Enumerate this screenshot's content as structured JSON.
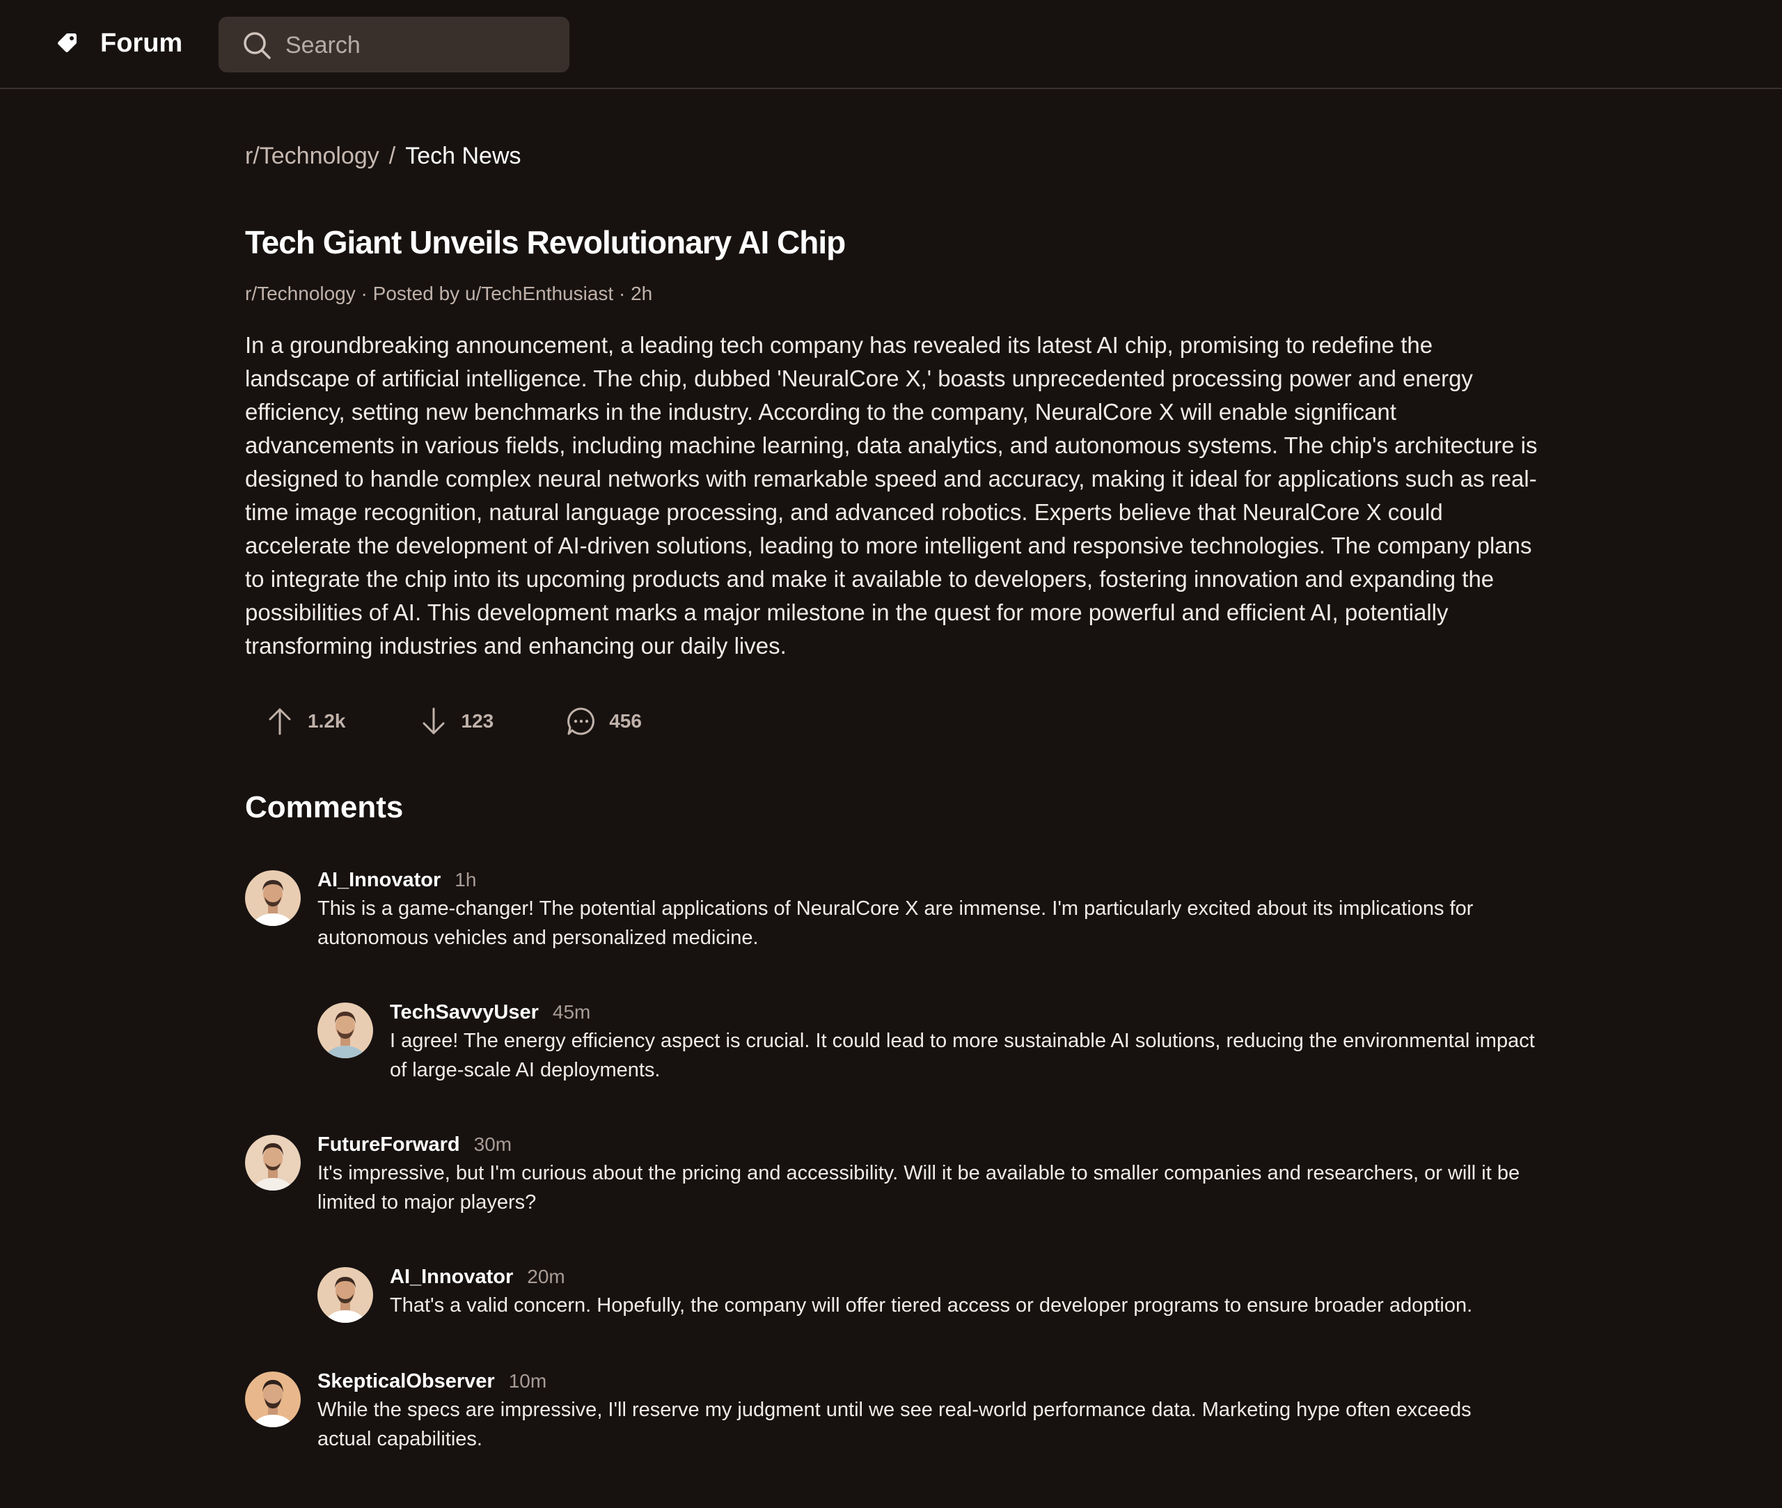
{
  "header": {
    "app_name": "Forum",
    "search_placeholder": "Search"
  },
  "breadcrumb": {
    "community": "r/Technology",
    "separator": "/",
    "current": "Tech News"
  },
  "post": {
    "title": "Tech Giant Unveils Revolutionary AI Chip",
    "meta": "r/Technology · Posted by u/TechEnthusiast · 2h",
    "body": "In a groundbreaking announcement, a leading tech company has revealed its latest AI chip, promising to redefine the landscape of artificial intelligence. The chip, dubbed 'NeuralCore X,' boasts unprecedented processing power and energy efficiency, setting new benchmarks in the industry. According to the company, NeuralCore X will enable significant advancements in various fields, including machine learning, data analytics, and autonomous systems. The chip's architecture is designed to handle complex neural networks with remarkable speed and accuracy, making it ideal for applications such as real-time image recognition, natural language processing, and advanced robotics. Experts believe that NeuralCore X could accelerate the development of AI-driven solutions, leading to more intelligent and responsive technologies. The company plans to integrate the chip into its upcoming products and make it available to developers, fostering innovation and expanding the possibilities of AI. This development marks a major milestone in the quest for more powerful and efficient AI, potentially transforming industries and enhancing our daily lives.",
    "upvotes": "1.2k",
    "downvotes": "123",
    "comment_count": "456"
  },
  "comments_heading": "Comments",
  "comments": [
    {
      "user": "AI_Innovator",
      "time": "1h",
      "text": "This is a game-changer! The potential applications of NeuralCore X are immense. I'm particularly excited about its implications for autonomous vehicles and personalized medicine."
    },
    {
      "user": "TechSavvyUser",
      "time": "45m",
      "text": "I agree! The energy efficiency aspect is crucial. It could lead to more sustainable AI solutions, reducing the environmental impact of large-scale AI deployments."
    },
    {
      "user": "FutureForward",
      "time": "30m",
      "text": "It's impressive, but I'm curious about the pricing and accessibility. Will it be available to smaller companies and researchers, or will it be limited to major players?"
    },
    {
      "user": "AI_Innovator",
      "time": "20m",
      "text": "That's a valid concern. Hopefully, the company will offer tiered access or developer programs to ensure broader adoption."
    },
    {
      "user": "SkepticalObserver",
      "time": "10m",
      "text": "While the specs are impressive, I'll reserve my judgment until we see real-world performance data. Marketing hype often exceeds actual capabilities."
    }
  ]
}
